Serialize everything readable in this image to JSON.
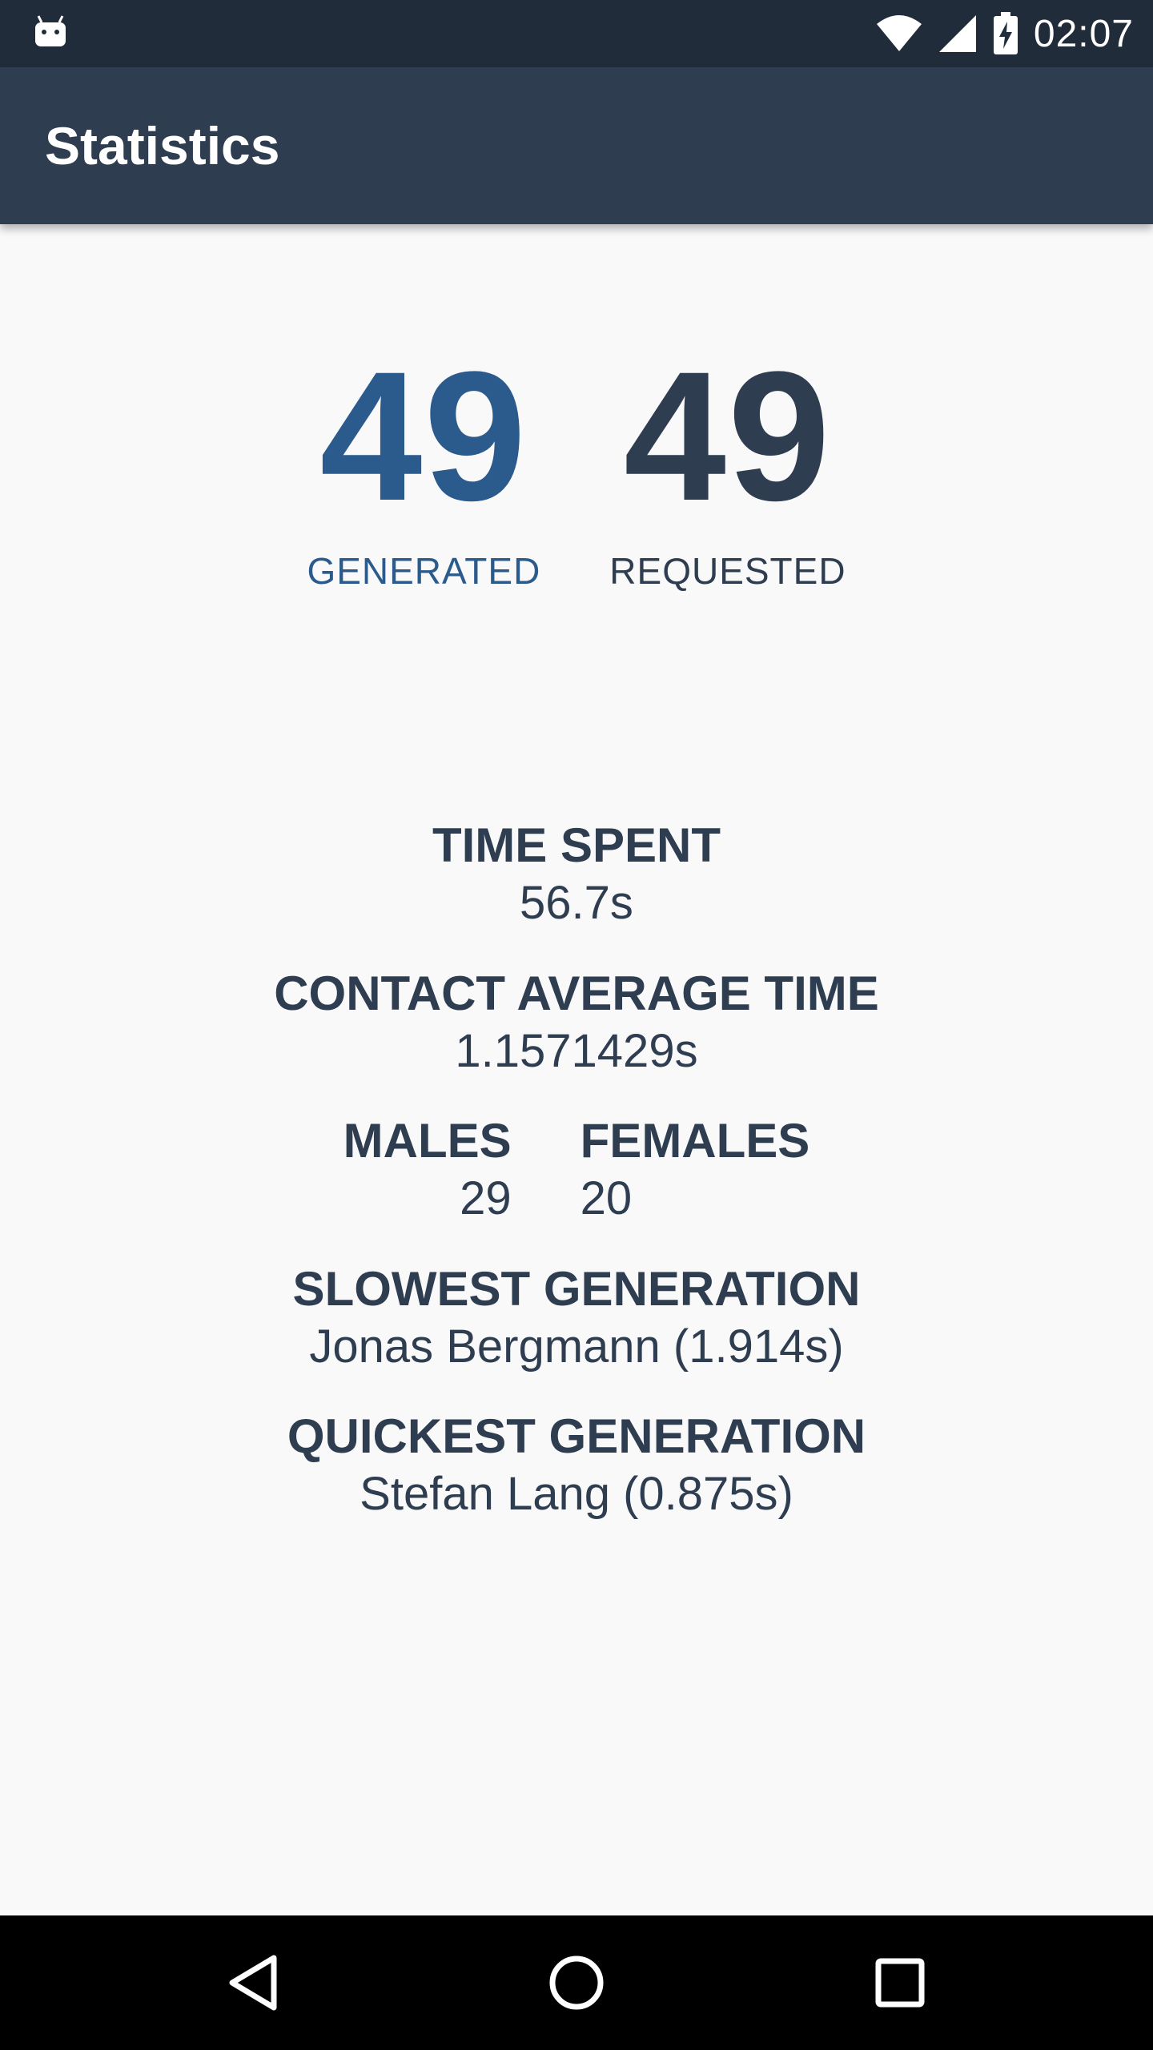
{
  "status_bar": {
    "time": "02:07",
    "icons": [
      "android-notification-icon",
      "wifi-icon",
      "cell-signal-icon",
      "battery-charging-icon"
    ]
  },
  "app_bar": {
    "title": "Statistics"
  },
  "counts": {
    "generated": {
      "value": "49",
      "label": "GENERATED"
    },
    "requested": {
      "value": "49",
      "label": "REQUESTED"
    }
  },
  "stats": {
    "time_spent": {
      "label": "TIME SPENT",
      "value": "56.7s"
    },
    "contact_average_time": {
      "label": "CONTACT AVERAGE TIME",
      "value": "1.1571429s"
    },
    "males": {
      "label": "MALES",
      "value": "29"
    },
    "females": {
      "label": "FEMALES",
      "value": "20"
    },
    "slowest_generation": {
      "label": "SLOWEST GENERATION",
      "value": "Jonas Bergmann (1.914s)"
    },
    "quickest_generation": {
      "label": "QUICKEST GENERATION",
      "value": "Stefan Lang (0.875s)"
    }
  },
  "nav_bar": {
    "icons": [
      "back-icon",
      "home-icon",
      "recents-icon"
    ]
  },
  "colors": {
    "status_bar": "#212c3a",
    "app_bar": "#2f3d50",
    "generated_accent": "#2b5a8c",
    "text_dark": "#2f3d50",
    "background": "#f9f9fa"
  }
}
